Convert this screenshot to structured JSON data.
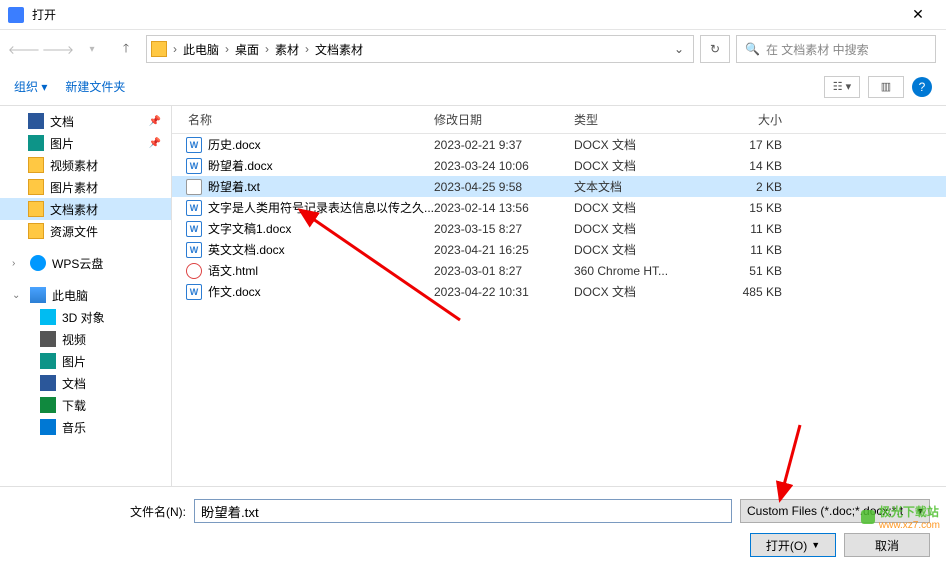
{
  "window": {
    "title": "打开"
  },
  "breadcrumb": {
    "items": [
      "此电脑",
      "桌面",
      "素材",
      "文档素材"
    ]
  },
  "search": {
    "placeholder": "在 文档素材 中搜索"
  },
  "toolbar": {
    "organize": "组织",
    "newfolder": "新建文件夹"
  },
  "sidebar": {
    "items": [
      {
        "label": "文档",
        "icon": "ticon-doc",
        "pinned": true
      },
      {
        "label": "图片",
        "icon": "ticon-pic",
        "pinned": true
      },
      {
        "label": "视频素材",
        "icon": "ticon-folder"
      },
      {
        "label": "图片素材",
        "icon": "ticon-folder"
      },
      {
        "label": "文档素材",
        "icon": "ticon-folder",
        "selected": true
      },
      {
        "label": "资源文件",
        "icon": "ticon-folder"
      }
    ],
    "wps": "WPS云盘",
    "thispc": {
      "label": "此电脑",
      "children": [
        {
          "label": "3D 对象",
          "icon": "ticon-3d"
        },
        {
          "label": "视频",
          "icon": "ticon-video"
        },
        {
          "label": "图片",
          "icon": "ticon-pic"
        },
        {
          "label": "文档",
          "icon": "ticon-doc"
        },
        {
          "label": "下载",
          "icon": "ticon-down"
        },
        {
          "label": "音乐",
          "icon": "ticon-music"
        }
      ]
    }
  },
  "columns": {
    "name": "名称",
    "date": "修改日期",
    "type": "类型",
    "size": "大小"
  },
  "files": [
    {
      "name": "历史.docx",
      "date": "2023-02-21 9:37",
      "type": "DOCX 文档",
      "size": "17 KB",
      "icon": "fi-docx"
    },
    {
      "name": "盼望着.docx",
      "date": "2023-03-24 10:06",
      "type": "DOCX 文档",
      "size": "14 KB",
      "icon": "fi-docx"
    },
    {
      "name": "盼望着.txt",
      "date": "2023-04-25 9:58",
      "type": "文本文档",
      "size": "2 KB",
      "icon": "fi-txt",
      "selected": true
    },
    {
      "name": "文字是人类用符号记录表达信息以传之久...",
      "date": "2023-02-14 13:56",
      "type": "DOCX 文档",
      "size": "15 KB",
      "icon": "fi-docx"
    },
    {
      "name": "文字文稿1.docx",
      "date": "2023-03-15 8:27",
      "type": "DOCX 文档",
      "size": "11 KB",
      "icon": "fi-docx"
    },
    {
      "name": "英文文档.docx",
      "date": "2023-04-21 16:25",
      "type": "DOCX 文档",
      "size": "11 KB",
      "icon": "fi-docx"
    },
    {
      "name": "语文.html",
      "date": "2023-03-01 8:27",
      "type": "360 Chrome HT...",
      "size": "51 KB",
      "icon": "fi-html"
    },
    {
      "name": "作文.docx",
      "date": "2023-04-22 10:31",
      "type": "DOCX 文档",
      "size": "485 KB",
      "icon": "fi-docx"
    }
  ],
  "footer": {
    "filename_label": "文件名(N):",
    "filename_value": "盼望着.txt",
    "filetype": "Custom Files (*.doc;*.docx;*.t",
    "open": "打开(O)",
    "cancel": "取消"
  },
  "watermark": {
    "name": "极光下载站",
    "url": "www.xz7.com"
  }
}
